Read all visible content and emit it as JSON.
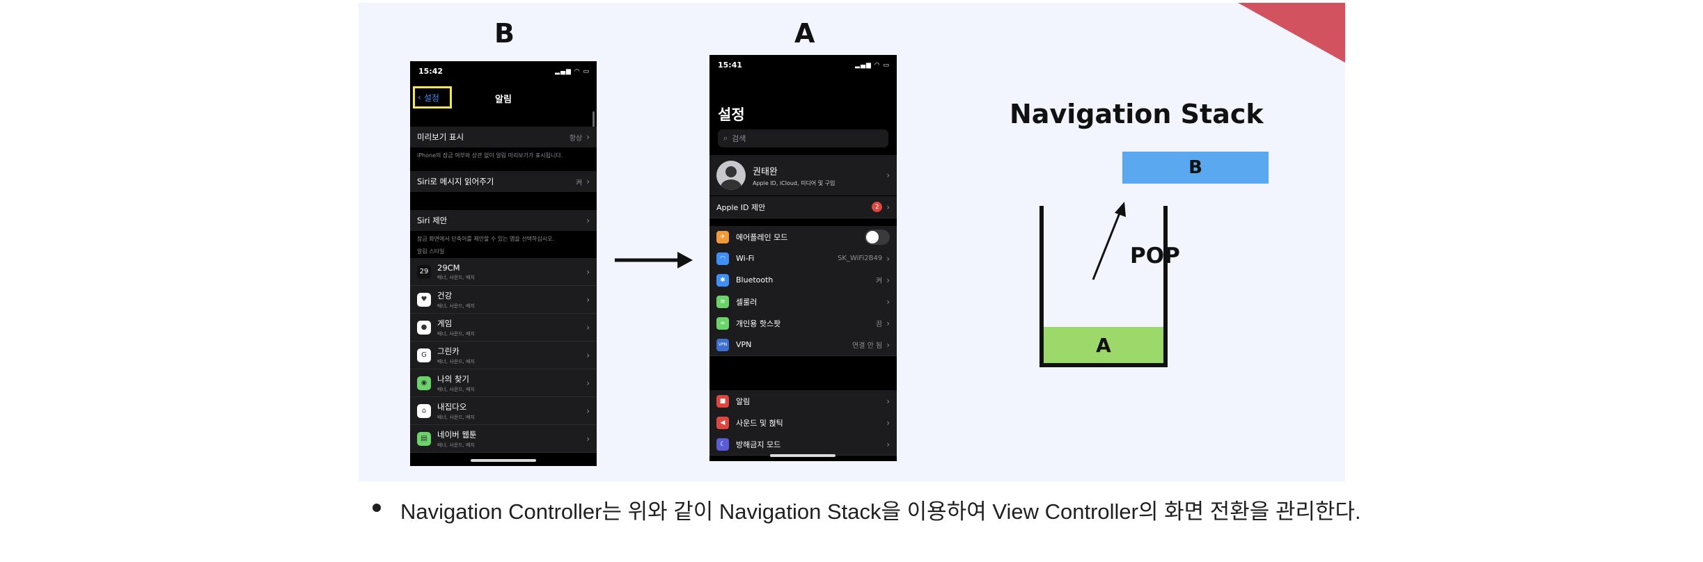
{
  "figure": {
    "label_b": "B",
    "label_a": "A",
    "phone_b": {
      "time": "15:42",
      "signal": "‥ ▴ ▭",
      "back_label": "設定",
      "back_label_ko": "설정",
      "nav_title": "알림",
      "preview_label": "미리보기 표시",
      "preview_value": "항상",
      "preview_note": "iPhone의 잠금 여부와 상관 없이 알림 미리보기가 표시됩니다.",
      "siri_read_label": "Siri로 메시지 읽어주기",
      "siri_read_value": "켜",
      "siri_suggest_label": "Siri 제안",
      "siri_suggest_note": "잠금 화면에서 단축어를 제안할 수 있는 앱을 선택하십시오.",
      "style_header": "알림 스타일",
      "apps": [
        {
          "name": "29CM",
          "sub": "배너, 사운드, 배지",
          "icon": "29",
          "color": "#111111"
        },
        {
          "name": "건강",
          "sub": "배너, 사운드, 배지",
          "icon": "♥",
          "color": "#ffffff"
        },
        {
          "name": "게임",
          "sub": "배너, 사운드, 배지",
          "icon": "●",
          "color": "#ffffff"
        },
        {
          "name": "그린카",
          "sub": "배너, 사운드, 배지",
          "icon": "G",
          "color": "#ffffff"
        },
        {
          "name": "나의 찾기",
          "sub": "배너, 사운드, 배지",
          "icon": "◉",
          "color": "#6cd26a"
        },
        {
          "name": "내집다오",
          "sub": "배너, 사운드, 배지",
          "icon": "⌂",
          "color": "#ffffff"
        },
        {
          "name": "네이버 웹툰",
          "sub": "배너, 사운드, 배지",
          "icon": "▤",
          "color": "#6cd26a"
        }
      ]
    },
    "phone_a": {
      "time": "15:41",
      "title": "설정",
      "search_placeholder": "검색",
      "profile_name": "권태완",
      "profile_sub": "Apple ID, iCloud, 미디어 및 구입",
      "appleid_label": "Apple ID 제안",
      "appleid_badge": "2",
      "rows": [
        {
          "label": "에어플레인 모드",
          "value": "",
          "icon": "✈",
          "color": "#f29a38",
          "toggle": true
        },
        {
          "label": "Wi-Fi",
          "value": "SK_WiFi2B49",
          "icon": "◠",
          "color": "#3e8ff7",
          "toggle": false
        },
        {
          "label": "Bluetooth",
          "value": "켜",
          "icon": "✱",
          "color": "#3e8ff7",
          "toggle": false
        },
        {
          "label": "셀룰러",
          "value": "",
          "icon": "≡",
          "color": "#6cd26a",
          "toggle": false
        },
        {
          "label": "개인용 핫스팟",
          "value": "끔",
          "icon": "∞",
          "color": "#6cd26a",
          "toggle": false
        },
        {
          "label": "VPN",
          "value": "연결 안 됨",
          "icon": "VPN",
          "color": "#3e6ed0",
          "toggle": false
        }
      ],
      "rows2": [
        {
          "label": "알림",
          "icon": "■",
          "color": "#e0463f"
        },
        {
          "label": "사운드 및 혅틱",
          "icon": "◀",
          "color": "#e0463f"
        },
        {
          "label": "방해금지 모드",
          "icon": "☾",
          "color": "#5b5bd6"
        }
      ]
    },
    "stack": {
      "title": "Navigation Stack",
      "box_b": "B",
      "box_a": "A",
      "pop_label": "POP"
    }
  },
  "bullet": {
    "text": "Navigation Controller는 위와 같이 Navigation Stack을 이용하여 View Controller의 화면 전환을 관리한다."
  }
}
